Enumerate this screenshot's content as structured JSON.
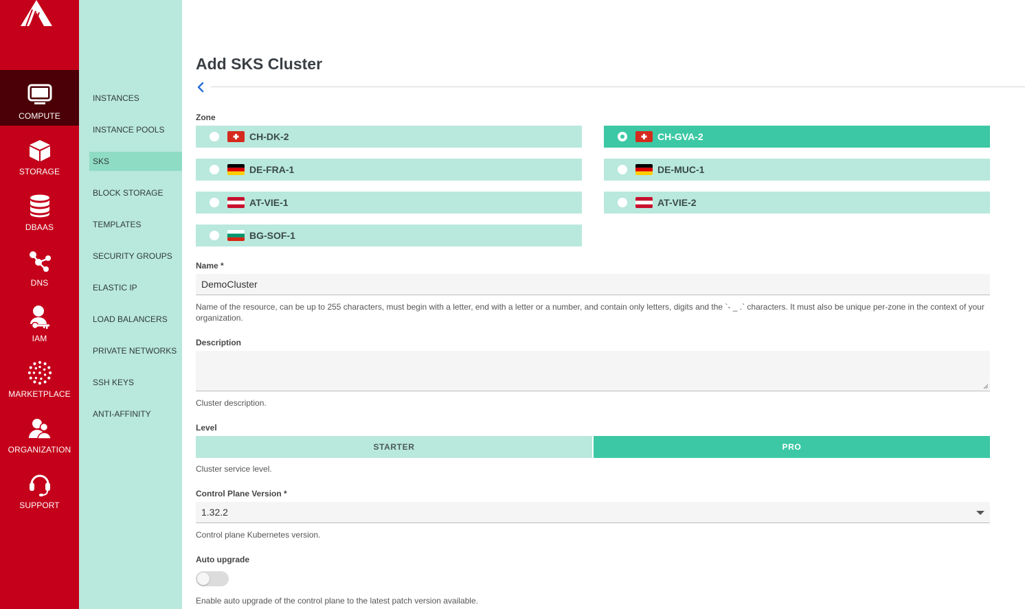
{
  "primary_nav": [
    {
      "label": "COMPUTE",
      "icon": "monitor-icon",
      "active": true
    },
    {
      "label": "STORAGE",
      "icon": "box-icon",
      "active": false
    },
    {
      "label": "DBAAS",
      "icon": "database-icon",
      "active": false
    },
    {
      "label": "DNS",
      "icon": "network-icon",
      "active": false
    },
    {
      "label": "IAM",
      "icon": "user-key-icon",
      "active": false
    },
    {
      "label": "MARKETPLACE",
      "icon": "dots-circle-icon",
      "active": false
    },
    {
      "label": "ORGANIZATION",
      "icon": "users-icon",
      "active": false
    },
    {
      "label": "SUPPORT",
      "icon": "headset-icon",
      "active": false
    }
  ],
  "secondary_nav": [
    {
      "label": "INSTANCES"
    },
    {
      "label": "INSTANCE POOLS"
    },
    {
      "label": "SKS",
      "active": true
    },
    {
      "label": "BLOCK STORAGE"
    },
    {
      "label": "TEMPLATES"
    },
    {
      "label": "SECURITY GROUPS"
    },
    {
      "label": "ELASTIC IP"
    },
    {
      "label": "LOAD BALANCERS"
    },
    {
      "label": "PRIVATE NETWORKS"
    },
    {
      "label": "SSH KEYS"
    },
    {
      "label": "ANTI-AFFINITY"
    }
  ],
  "page": {
    "title": "Add SKS Cluster"
  },
  "zone": {
    "label": "Zone",
    "options": [
      {
        "name": "CH-DK-2",
        "flag": "switzerland",
        "selected": false
      },
      {
        "name": "CH-GVA-2",
        "flag": "switzerland",
        "selected": true
      },
      {
        "name": "DE-FRA-1",
        "flag": "germany",
        "selected": false
      },
      {
        "name": "DE-MUC-1",
        "flag": "germany",
        "selected": false
      },
      {
        "name": "AT-VIE-1",
        "flag": "austria",
        "selected": false
      },
      {
        "name": "AT-VIE-2",
        "flag": "austria",
        "selected": false
      },
      {
        "name": "BG-SOF-1",
        "flag": "bulgaria",
        "selected": false
      }
    ]
  },
  "name": {
    "label": "Name *",
    "value": "DemoCluster",
    "help": "Name of the resource, can be up to 255 characters, must begin with a letter, end with a letter or a number, and contain only letters, digits and the `- _ .` characters. It must also be unique per-zone in the context of your organization."
  },
  "description": {
    "label": "Description",
    "value": "",
    "help": "Cluster description."
  },
  "level": {
    "label": "Level",
    "options": [
      {
        "name": "STARTER",
        "selected": false
      },
      {
        "name": "PRO",
        "selected": true
      }
    ],
    "help": "Cluster service level."
  },
  "control_plane": {
    "label": "Control Plane Version *",
    "value": "1.32.2",
    "help": "Control plane Kubernetes version."
  },
  "auto_upgrade": {
    "label": "Auto upgrade",
    "enabled": false,
    "help": "Enable auto upgrade of the control plane to the latest patch version available."
  },
  "colors": {
    "brand_red": "#c4001a",
    "nav_active": "#4a0006",
    "mint": "#b9e8dc",
    "mint_active": "#8fdcc5",
    "accent": "#3cc8a4"
  }
}
